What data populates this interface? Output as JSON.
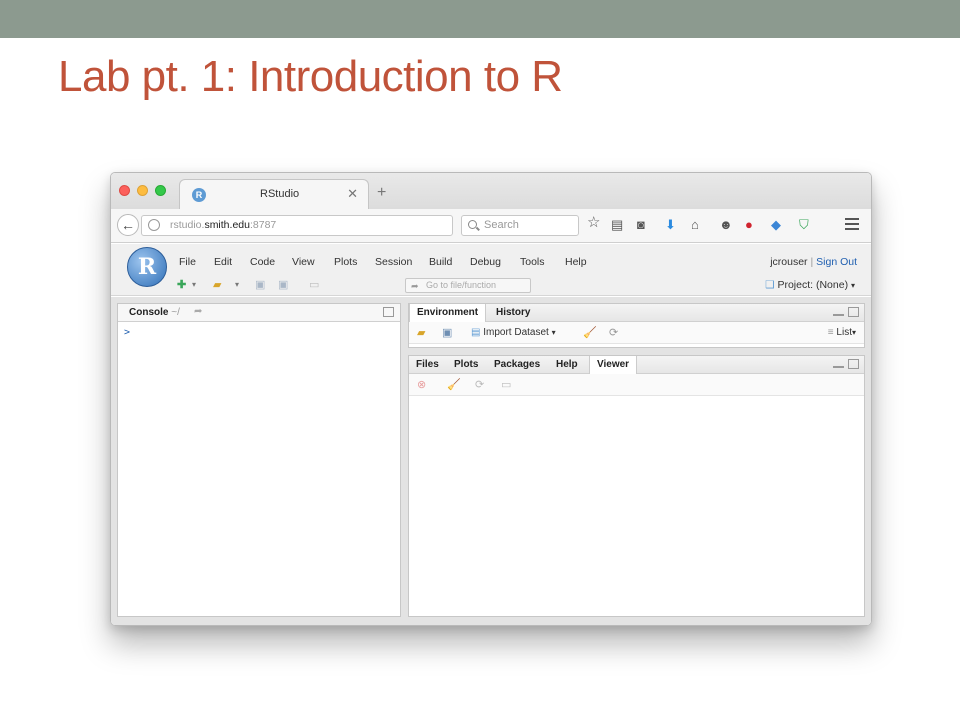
{
  "slide": {
    "title": "Lab pt. 1: Introduction to R"
  },
  "browser": {
    "tab_title": "RStudio",
    "tab_close": "✕",
    "new_tab": "+",
    "url_host": "rstudio.smith.edu",
    "url_prefix": "rstudio.",
    "url_domain": "smith.edu",
    "url_port": ":8787",
    "search_placeholder": "Search"
  },
  "rstudio": {
    "menu": [
      "File",
      "Edit",
      "Code",
      "View",
      "Plots",
      "Session",
      "Build",
      "Debug",
      "Tools",
      "Help"
    ],
    "user": "jcrouser",
    "user_sep": "|",
    "sign_out": "Sign Out",
    "goto_placeholder": "Go to file/function",
    "project": "Project: (None)"
  },
  "console": {
    "tab": "Console",
    "path": "~/",
    "prompt": ">"
  },
  "env_pane": {
    "tabs": [
      "Environment",
      "History"
    ],
    "import_label": "Import Dataset",
    "view_mode": "List"
  },
  "files_pane": {
    "tabs": [
      "Files",
      "Plots",
      "Packages",
      "Help",
      "Viewer"
    ],
    "active_tab": "Viewer"
  }
}
